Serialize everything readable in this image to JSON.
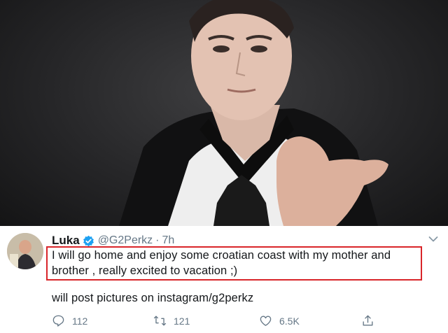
{
  "tweet": {
    "display_name": "Luka",
    "handle": "@G2Perkz",
    "separator": "·",
    "timestamp": "7h",
    "text_line1": "I will go home and enjoy some croatian coast with my mother and",
    "text_line2": "brother , really excited to vacation ;)",
    "text_line3": "will post pictures on instagram/g2perkz",
    "highlight_color": "#d9252a",
    "verified_color": "#1da1f2"
  },
  "actions": {
    "reply_count": "112",
    "retweet_count": "121",
    "like_count": "6.5K",
    "icons": [
      "reply-icon",
      "retweet-icon",
      "like-icon",
      "share-icon"
    ]
  }
}
